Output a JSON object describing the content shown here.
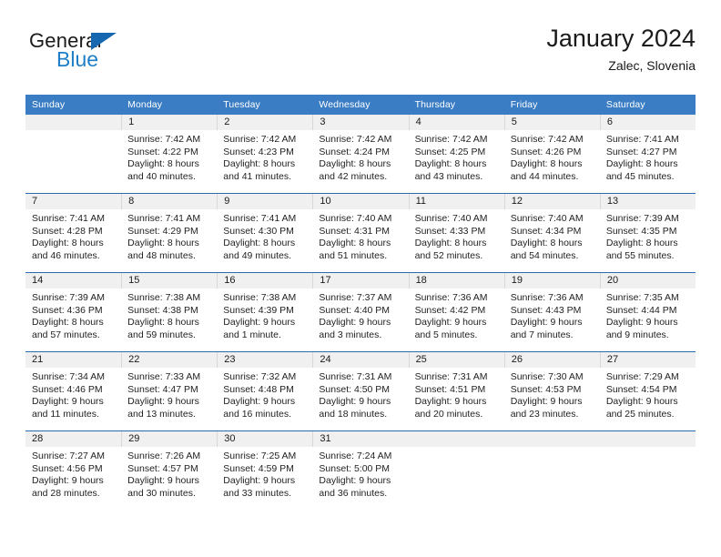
{
  "brand": {
    "name_part1": "General",
    "name_part2": "Blue",
    "triangle_color": "#1567b0",
    "blue_color": "#1e7fc8"
  },
  "header": {
    "title": "January 2024",
    "subtitle": "Zalec, Slovenia"
  },
  "theme": {
    "header_band": "#3b7dc4",
    "row_separator": "#2b6cb0",
    "daynum_band": "#f0f0f0",
    "text": "#1a1a1a"
  },
  "weekdays": [
    "Sunday",
    "Monday",
    "Tuesday",
    "Wednesday",
    "Thursday",
    "Friday",
    "Saturday"
  ],
  "weeks": [
    [
      {
        "day": "",
        "lines": []
      },
      {
        "day": "1",
        "lines": [
          "Sunrise: 7:42 AM",
          "Sunset: 4:22 PM",
          "Daylight: 8 hours",
          "and 40 minutes."
        ]
      },
      {
        "day": "2",
        "lines": [
          "Sunrise: 7:42 AM",
          "Sunset: 4:23 PM",
          "Daylight: 8 hours",
          "and 41 minutes."
        ]
      },
      {
        "day": "3",
        "lines": [
          "Sunrise: 7:42 AM",
          "Sunset: 4:24 PM",
          "Daylight: 8 hours",
          "and 42 minutes."
        ]
      },
      {
        "day": "4",
        "lines": [
          "Sunrise: 7:42 AM",
          "Sunset: 4:25 PM",
          "Daylight: 8 hours",
          "and 43 minutes."
        ]
      },
      {
        "day": "5",
        "lines": [
          "Sunrise: 7:42 AM",
          "Sunset: 4:26 PM",
          "Daylight: 8 hours",
          "and 44 minutes."
        ]
      },
      {
        "day": "6",
        "lines": [
          "Sunrise: 7:41 AM",
          "Sunset: 4:27 PM",
          "Daylight: 8 hours",
          "and 45 minutes."
        ]
      }
    ],
    [
      {
        "day": "7",
        "lines": [
          "Sunrise: 7:41 AM",
          "Sunset: 4:28 PM",
          "Daylight: 8 hours",
          "and 46 minutes."
        ]
      },
      {
        "day": "8",
        "lines": [
          "Sunrise: 7:41 AM",
          "Sunset: 4:29 PM",
          "Daylight: 8 hours",
          "and 48 minutes."
        ]
      },
      {
        "day": "9",
        "lines": [
          "Sunrise: 7:41 AM",
          "Sunset: 4:30 PM",
          "Daylight: 8 hours",
          "and 49 minutes."
        ]
      },
      {
        "day": "10",
        "lines": [
          "Sunrise: 7:40 AM",
          "Sunset: 4:31 PM",
          "Daylight: 8 hours",
          "and 51 minutes."
        ]
      },
      {
        "day": "11",
        "lines": [
          "Sunrise: 7:40 AM",
          "Sunset: 4:33 PM",
          "Daylight: 8 hours",
          "and 52 minutes."
        ]
      },
      {
        "day": "12",
        "lines": [
          "Sunrise: 7:40 AM",
          "Sunset: 4:34 PM",
          "Daylight: 8 hours",
          "and 54 minutes."
        ]
      },
      {
        "day": "13",
        "lines": [
          "Sunrise: 7:39 AM",
          "Sunset: 4:35 PM",
          "Daylight: 8 hours",
          "and 55 minutes."
        ]
      }
    ],
    [
      {
        "day": "14",
        "lines": [
          "Sunrise: 7:39 AM",
          "Sunset: 4:36 PM",
          "Daylight: 8 hours",
          "and 57 minutes."
        ]
      },
      {
        "day": "15",
        "lines": [
          "Sunrise: 7:38 AM",
          "Sunset: 4:38 PM",
          "Daylight: 8 hours",
          "and 59 minutes."
        ]
      },
      {
        "day": "16",
        "lines": [
          "Sunrise: 7:38 AM",
          "Sunset: 4:39 PM",
          "Daylight: 9 hours",
          "and 1 minute."
        ]
      },
      {
        "day": "17",
        "lines": [
          "Sunrise: 7:37 AM",
          "Sunset: 4:40 PM",
          "Daylight: 9 hours",
          "and 3 minutes."
        ]
      },
      {
        "day": "18",
        "lines": [
          "Sunrise: 7:36 AM",
          "Sunset: 4:42 PM",
          "Daylight: 9 hours",
          "and 5 minutes."
        ]
      },
      {
        "day": "19",
        "lines": [
          "Sunrise: 7:36 AM",
          "Sunset: 4:43 PM",
          "Daylight: 9 hours",
          "and 7 minutes."
        ]
      },
      {
        "day": "20",
        "lines": [
          "Sunrise: 7:35 AM",
          "Sunset: 4:44 PM",
          "Daylight: 9 hours",
          "and 9 minutes."
        ]
      }
    ],
    [
      {
        "day": "21",
        "lines": [
          "Sunrise: 7:34 AM",
          "Sunset: 4:46 PM",
          "Daylight: 9 hours",
          "and 11 minutes."
        ]
      },
      {
        "day": "22",
        "lines": [
          "Sunrise: 7:33 AM",
          "Sunset: 4:47 PM",
          "Daylight: 9 hours",
          "and 13 minutes."
        ]
      },
      {
        "day": "23",
        "lines": [
          "Sunrise: 7:32 AM",
          "Sunset: 4:48 PM",
          "Daylight: 9 hours",
          "and 16 minutes."
        ]
      },
      {
        "day": "24",
        "lines": [
          "Sunrise: 7:31 AM",
          "Sunset: 4:50 PM",
          "Daylight: 9 hours",
          "and 18 minutes."
        ]
      },
      {
        "day": "25",
        "lines": [
          "Sunrise: 7:31 AM",
          "Sunset: 4:51 PM",
          "Daylight: 9 hours",
          "and 20 minutes."
        ]
      },
      {
        "day": "26",
        "lines": [
          "Sunrise: 7:30 AM",
          "Sunset: 4:53 PM",
          "Daylight: 9 hours",
          "and 23 minutes."
        ]
      },
      {
        "day": "27",
        "lines": [
          "Sunrise: 7:29 AM",
          "Sunset: 4:54 PM",
          "Daylight: 9 hours",
          "and 25 minutes."
        ]
      }
    ],
    [
      {
        "day": "28",
        "lines": [
          "Sunrise: 7:27 AM",
          "Sunset: 4:56 PM",
          "Daylight: 9 hours",
          "and 28 minutes."
        ]
      },
      {
        "day": "29",
        "lines": [
          "Sunrise: 7:26 AM",
          "Sunset: 4:57 PM",
          "Daylight: 9 hours",
          "and 30 minutes."
        ]
      },
      {
        "day": "30",
        "lines": [
          "Sunrise: 7:25 AM",
          "Sunset: 4:59 PM",
          "Daylight: 9 hours",
          "and 33 minutes."
        ]
      },
      {
        "day": "31",
        "lines": [
          "Sunrise: 7:24 AM",
          "Sunset: 5:00 PM",
          "Daylight: 9 hours",
          "and 36 minutes."
        ]
      },
      {
        "day": "",
        "lines": []
      },
      {
        "day": "",
        "lines": []
      },
      {
        "day": "",
        "lines": []
      }
    ]
  ]
}
